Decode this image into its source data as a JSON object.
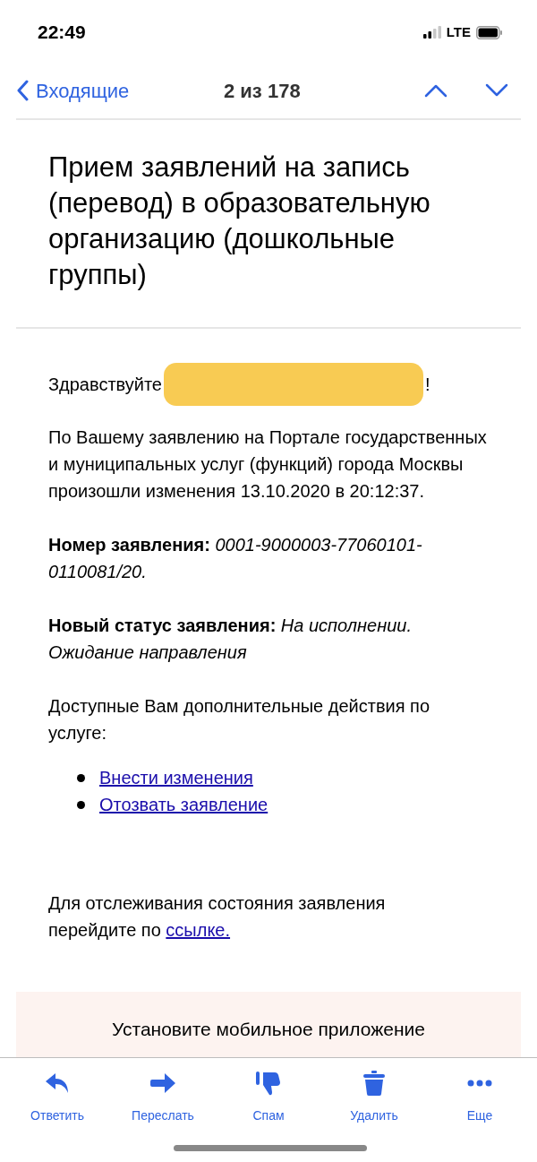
{
  "status_bar": {
    "time": "22:49",
    "network": "LTE"
  },
  "nav": {
    "back": "Входящие",
    "position": "2 из 178"
  },
  "subject": "Прием заявлений на запись (перевод) в образовательную организацию (дошкольные группы)",
  "body": {
    "greeting": "Здравствуйте",
    "greeting_end": "!",
    "intro": "По Вашему заявлению на Портале государственных и муниципальных услуг (функций) города Москвы произошли изменения 13.10.2020 в 20:12:37.",
    "number_label": "Номер заявления:",
    "number_value": "0001-9000003-77060101-0110081/20.",
    "status_label": "Новый статус заявления:",
    "status_value": "На исполнении. Ожидание направления",
    "actions_title": "Доступные Вам дополнительные действия по услуге:",
    "actions": [
      "Внести изменения",
      "Отозвать заявление"
    ],
    "tracking_text": "Для отслеживания состояния заявления перейдите по",
    "tracking_link": "ссылке.",
    "banner": "Установите мобильное приложение"
  },
  "toolbar": [
    {
      "kind": "reply",
      "label": "Ответить"
    },
    {
      "kind": "forward",
      "label": "Переслать"
    },
    {
      "kind": "spam",
      "label": "Спам"
    },
    {
      "kind": "delete",
      "label": "Удалить"
    },
    {
      "kind": "more",
      "label": "Еще"
    }
  ]
}
